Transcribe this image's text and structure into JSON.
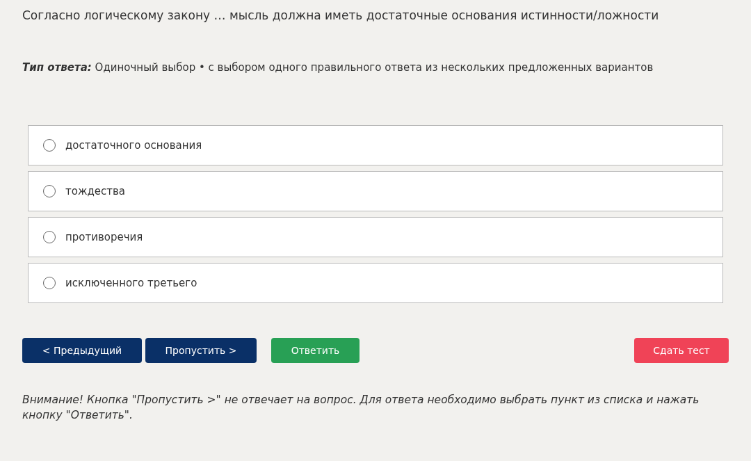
{
  "question": "Согласно логическому закону … мысль должна иметь достаточные основания истинности/ложности",
  "answer_type": {
    "label": "Тип ответа:",
    "value": "Одиночный выбор • с выбором одного правильного ответа из нескольких предложенных вариантов"
  },
  "options": [
    {
      "label": "достаточного основания",
      "selected": false
    },
    {
      "label": "тождества",
      "selected": false
    },
    {
      "label": "противоречия",
      "selected": false
    },
    {
      "label": "исключенного третьего",
      "selected": false
    }
  ],
  "buttons": [
    {
      "label": "< Предыдущий",
      "kind": "nav"
    },
    {
      "label": "Пропустить >",
      "kind": "nav"
    },
    {
      "label": "Ответить",
      "kind": "answer"
    },
    {
      "label": "Сдать тест",
      "kind": "finish"
    }
  ],
  "notice": "Внимание! Кнопка \"Пропустить >\" не отвечает на вопрос. Для ответа необходимо выбрать пункт из списка и нажать кнопку \"Ответить\"."
}
